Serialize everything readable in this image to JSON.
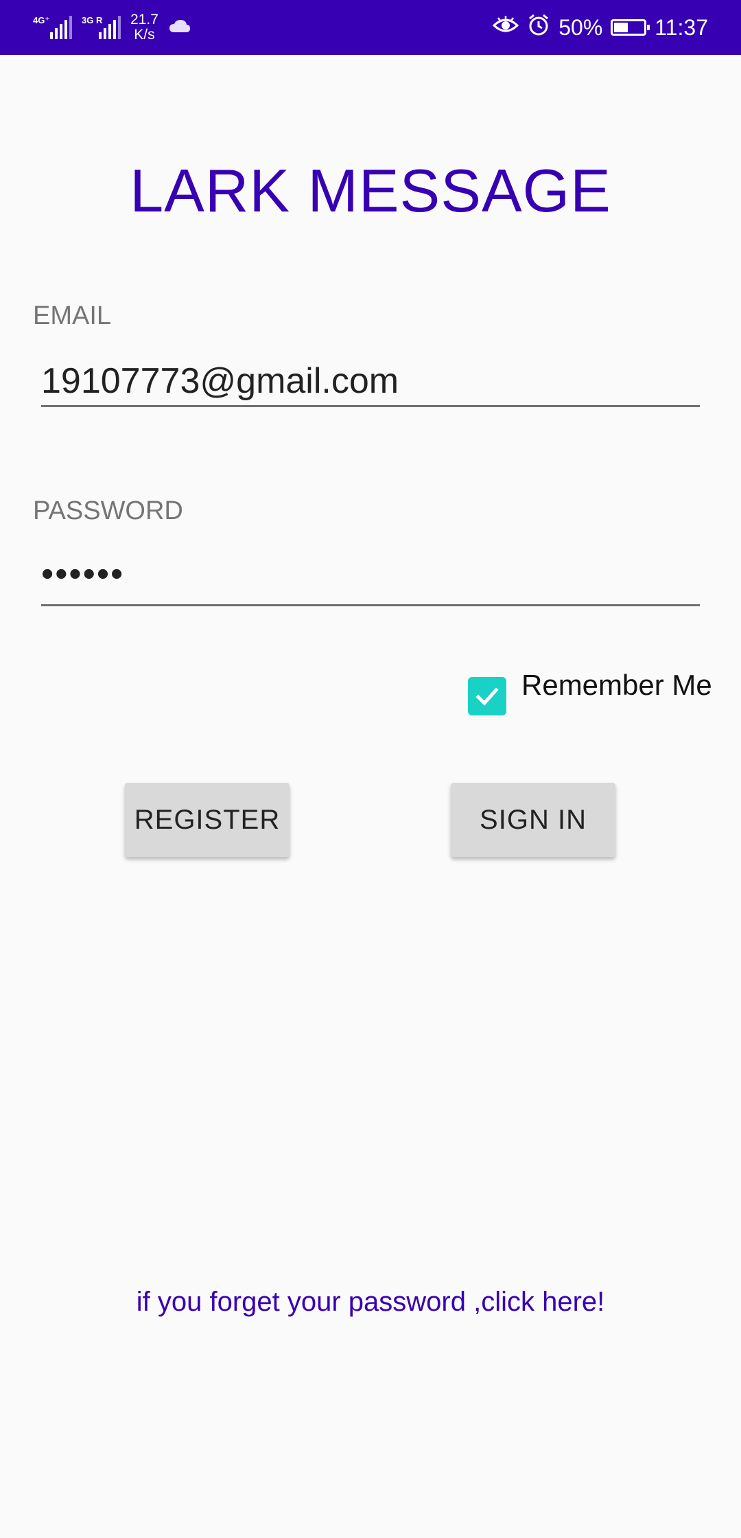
{
  "status_bar": {
    "network_1": "4G⁺",
    "network_2": "3G R",
    "speed_value": "21.7",
    "speed_unit": "K/s",
    "battery_percent": "50%",
    "battery_level": 0.5,
    "time": "11:37",
    "icons": [
      "eye-icon",
      "alarm-icon",
      "battery-icon",
      "cloud-icon"
    ],
    "color": "#3700b3"
  },
  "app": {
    "title": "LARK MESSAGE",
    "accent_color": "#3700b3"
  },
  "form": {
    "email_label": "EMAIL",
    "email_value": "19107773@gmail.com",
    "password_label": "PASSWORD",
    "password_masked": "••••••",
    "remember_label": "Remember Me",
    "remember_checked": true,
    "checkbox_color": "#1ad1c6"
  },
  "buttons": {
    "register_label": "REGISTER",
    "sign_in_label": "SIGN IN"
  },
  "footer": {
    "forgot_text": "if you forget your password ,click here!"
  }
}
